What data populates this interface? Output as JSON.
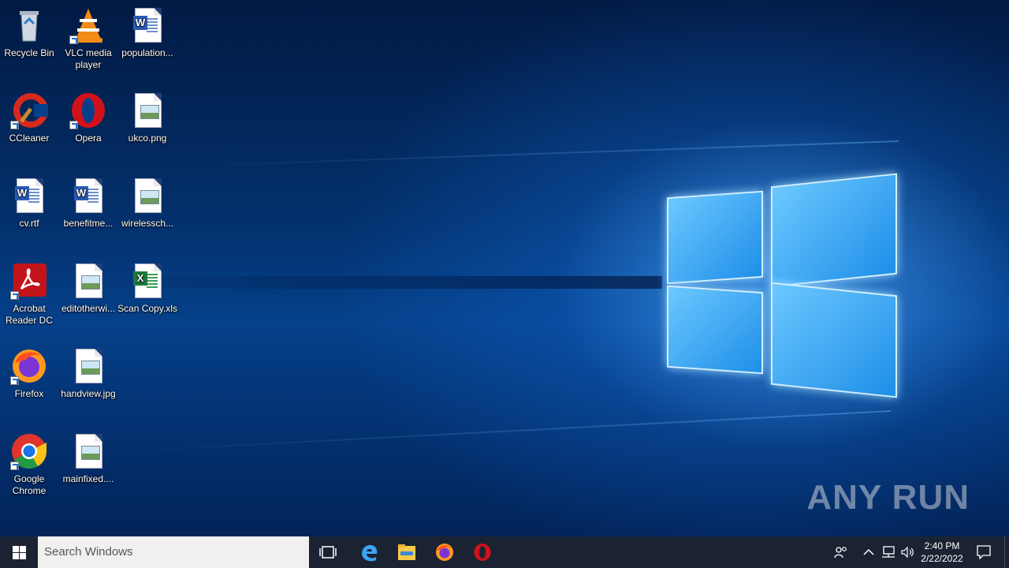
{
  "desktop_icons": [
    {
      "label": "Recycle Bin",
      "icon": "recycle-bin-icon"
    },
    {
      "label": "VLC media player",
      "icon": "vlc-icon"
    },
    {
      "label": "population...",
      "icon": "word-doc-icon"
    },
    {
      "label": "CCleaner",
      "icon": "ccleaner-icon"
    },
    {
      "label": "Opera",
      "icon": "opera-icon"
    },
    {
      "label": "ukco.png",
      "icon": "image-file-icon"
    },
    {
      "label": "cv.rtf",
      "icon": "word-doc-icon"
    },
    {
      "label": "benefitme...",
      "icon": "word-doc-icon"
    },
    {
      "label": "wirelessch...",
      "icon": "image-file-icon"
    },
    {
      "label": "Acrobat Reader DC",
      "icon": "acrobat-icon"
    },
    {
      "label": "editotherwi...",
      "icon": "image-file-icon"
    },
    {
      "label": "Scan Copy.xls",
      "icon": "excel-doc-icon"
    },
    {
      "label": "Firefox",
      "icon": "firefox-icon"
    },
    {
      "label": "handview.jpg",
      "icon": "image-file-icon"
    },
    {
      "label": "Google Chrome",
      "icon": "chrome-icon"
    },
    {
      "label": "mainfixed....",
      "icon": "image-file-icon"
    }
  ],
  "taskbar": {
    "search_placeholder": "Search Windows",
    "pinned": [
      "task-view-icon",
      "edge-icon",
      "file-explorer-icon",
      "firefox-icon",
      "opera-icon"
    ],
    "tray_icons": [
      "people-icon",
      "chevron-up-icon",
      "network-icon",
      "volume-icon"
    ],
    "clock_time": "2:40 PM",
    "clock_date": "2/22/2022",
    "notification_icon": "action-center-icon"
  },
  "watermark": "ANY RUN",
  "colors": {
    "taskbar_bg": "#1b2333",
    "search_bg": "#f0f0f0",
    "accent": "#1f8fe8"
  }
}
